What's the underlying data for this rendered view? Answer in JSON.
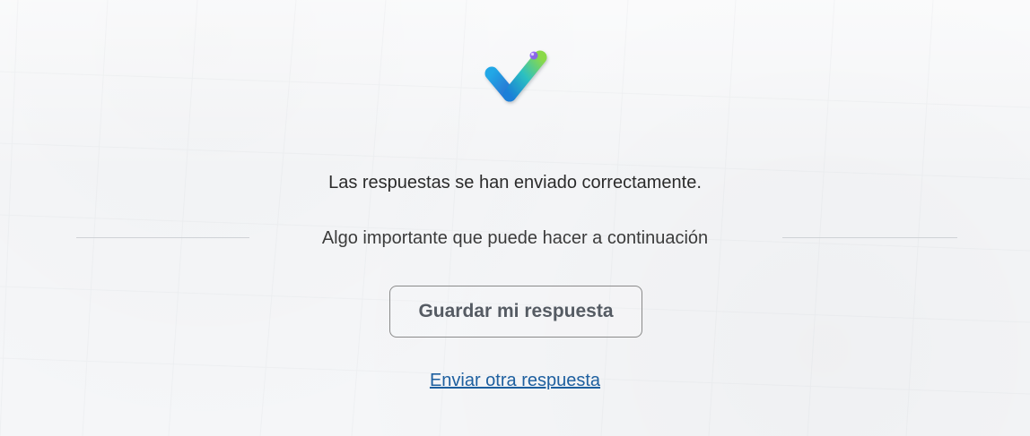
{
  "confirmation": {
    "success_message": "Las respuestas se han enviado correctamente.",
    "next_steps_title": "Algo importante que puede hacer a continuación",
    "save_button_label": "Guardar mi respuesta",
    "send_another_link": "Enviar otra respuesta"
  },
  "icons": {
    "success": "check-icon"
  },
  "colors": {
    "link": "#1d5f9f",
    "button_text": "#555b63",
    "button_border": "#8a8a8a",
    "divider": "#cfd2d6",
    "background": "#f5f6f8"
  }
}
